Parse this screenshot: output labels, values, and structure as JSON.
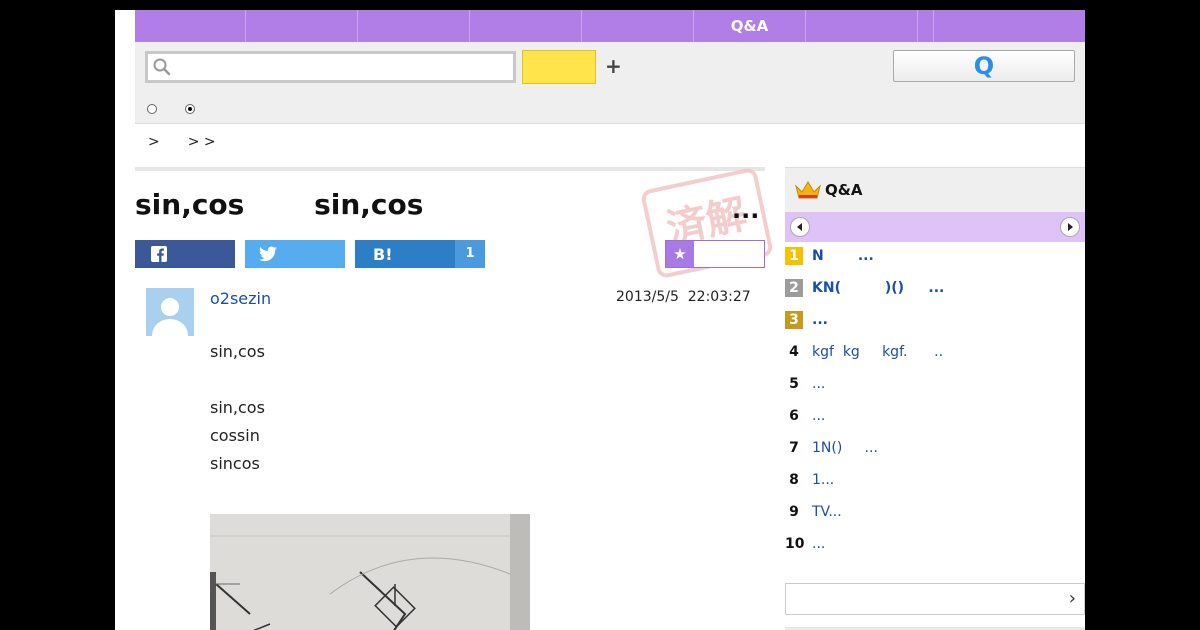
{
  "nav": {
    "items": [
      "",
      "",
      "",
      "",
      "",
      "Q&A",
      "",
      "",
      ""
    ]
  },
  "search": {
    "placeholder": "",
    "value": "",
    "button_label": "",
    "plus": "+",
    "ask_label": "Q"
  },
  "breadcrumb": [
    "",
    ">",
    "",
    "> >"
  ],
  "question": {
    "title": "sin,cos sin,cos",
    "more": "...",
    "stamp": "済解",
    "share": {
      "facebook_icon": "f",
      "twitter_icon": "twitter-bird",
      "hatena_label": "B!",
      "hatena_count": "1"
    },
    "fav_star": "★",
    "user": "o2sezin",
    "timestamp": "2013/5/5  22:03:27",
    "body": [
      "sin,cos",
      "sin,cos",
      "cossin",
      "sincos"
    ]
  },
  "sidebar": {
    "ranking_title": "Q&A",
    "items": [
      {
        "rank": "1",
        "text": "N       ...",
        "bold": true,
        "medal": "gold"
      },
      {
        "rank": "2",
        "text": "KN(         )()     ...",
        "bold": true,
        "medal": "silver"
      },
      {
        "rank": "3",
        "text": "...",
        "bold": true,
        "medal": "bronze"
      },
      {
        "rank": "4",
        "text": "kgf  kg     kgf.      ..",
        "bold": false,
        "medal": ""
      },
      {
        "rank": "5",
        "text": "...",
        "bold": false,
        "medal": ""
      },
      {
        "rank": "6",
        "text": "...",
        "bold": false,
        "medal": ""
      },
      {
        "rank": "7",
        "text": "1N()     ...",
        "bold": false,
        "medal": ""
      },
      {
        "rank": "8",
        "text": "1...",
        "bold": false,
        "medal": ""
      },
      {
        "rank": "9",
        "text": "TV...",
        "bold": false,
        "medal": ""
      },
      {
        "rank": "10",
        "text": "...",
        "bold": false,
        "medal": ""
      }
    ],
    "more_chevron": "›"
  },
  "colors": {
    "nav": "#b07ee6",
    "accent_yellow": "#ffe44b",
    "link": "#1a4fa8"
  }
}
